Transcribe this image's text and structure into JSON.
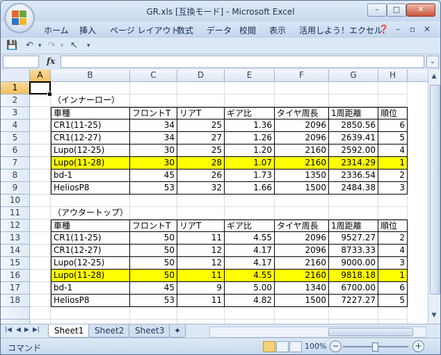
{
  "window": {
    "title": "GR.xls  [互換モード] - Microsoft Excel"
  },
  "ribbon_tabs": [
    "ホーム",
    "挿入",
    "ページ レイアウト",
    "数式",
    "データ",
    "校閲",
    "表示",
    "活用しよう！エクセル"
  ],
  "formula_bar": {
    "fx": "fx",
    "name_box": "",
    "content": ""
  },
  "columns": [
    "A",
    "B",
    "C",
    "D",
    "E",
    "F",
    "G",
    "H"
  ],
  "rows": [
    "1",
    "2",
    "3",
    "4",
    "5",
    "6",
    "7",
    "8",
    "9",
    "10",
    "11",
    "12",
    "13",
    "14",
    "15",
    "16",
    "17",
    "18"
  ],
  "section1": {
    "title": "（インナーロー）",
    "headers": [
      "車種",
      "フロントT",
      "リアT",
      "ギア比",
      "タイヤ周長",
      "1周距離",
      "順位"
    ],
    "rows": [
      [
        "CR1(11-25)",
        "34",
        "25",
        "1.36",
        "2096",
        "2850.56",
        "6"
      ],
      [
        "CR1(12-27)",
        "34",
        "27",
        "1.26",
        "2096",
        "2639.41",
        "5"
      ],
      [
        "Lupo(12-25)",
        "30",
        "25",
        "1.20",
        "2160",
        "2592.00",
        "4"
      ],
      [
        "Lupo(11-28)",
        "30",
        "28",
        "1.07",
        "2160",
        "2314.29",
        "1"
      ],
      [
        "bd-1",
        "45",
        "26",
        "1.73",
        "1350",
        "2336.54",
        "2"
      ],
      [
        "HeliosP8",
        "53",
        "32",
        "1.66",
        "1500",
        "2484.38",
        "3"
      ]
    ],
    "highlight_row": 3
  },
  "section2": {
    "title": "（アウタートップ）",
    "headers": [
      "車種",
      "フロントT",
      "リアT",
      "ギア比",
      "タイヤ周長",
      "1周距離",
      "順位"
    ],
    "rows": [
      [
        "CR1(11-25)",
        "50",
        "11",
        "4.55",
        "2096",
        "9527.27",
        "2"
      ],
      [
        "CR1(12-27)",
        "50",
        "12",
        "4.17",
        "2096",
        "8733.33",
        "4"
      ],
      [
        "Lupo(12-25)",
        "50",
        "12",
        "4.17",
        "2160",
        "9000.00",
        "3"
      ],
      [
        "Lupo(11-28)",
        "50",
        "11",
        "4.55",
        "2160",
        "9818.18",
        "1"
      ],
      [
        "bd-1",
        "45",
        "9",
        "5.00",
        "1340",
        "6700.00",
        "6"
      ],
      [
        "HeliosP8",
        "53",
        "11",
        "4.82",
        "1500",
        "7227.27",
        "5"
      ]
    ],
    "highlight_row": 3
  },
  "highlight_color": "#ffff00",
  "sheets": [
    "Sheet1",
    "Sheet2",
    "Sheet3"
  ],
  "active_sheet": "Sheet1",
  "status": {
    "mode": "コマンド",
    "zoom": "100%"
  }
}
